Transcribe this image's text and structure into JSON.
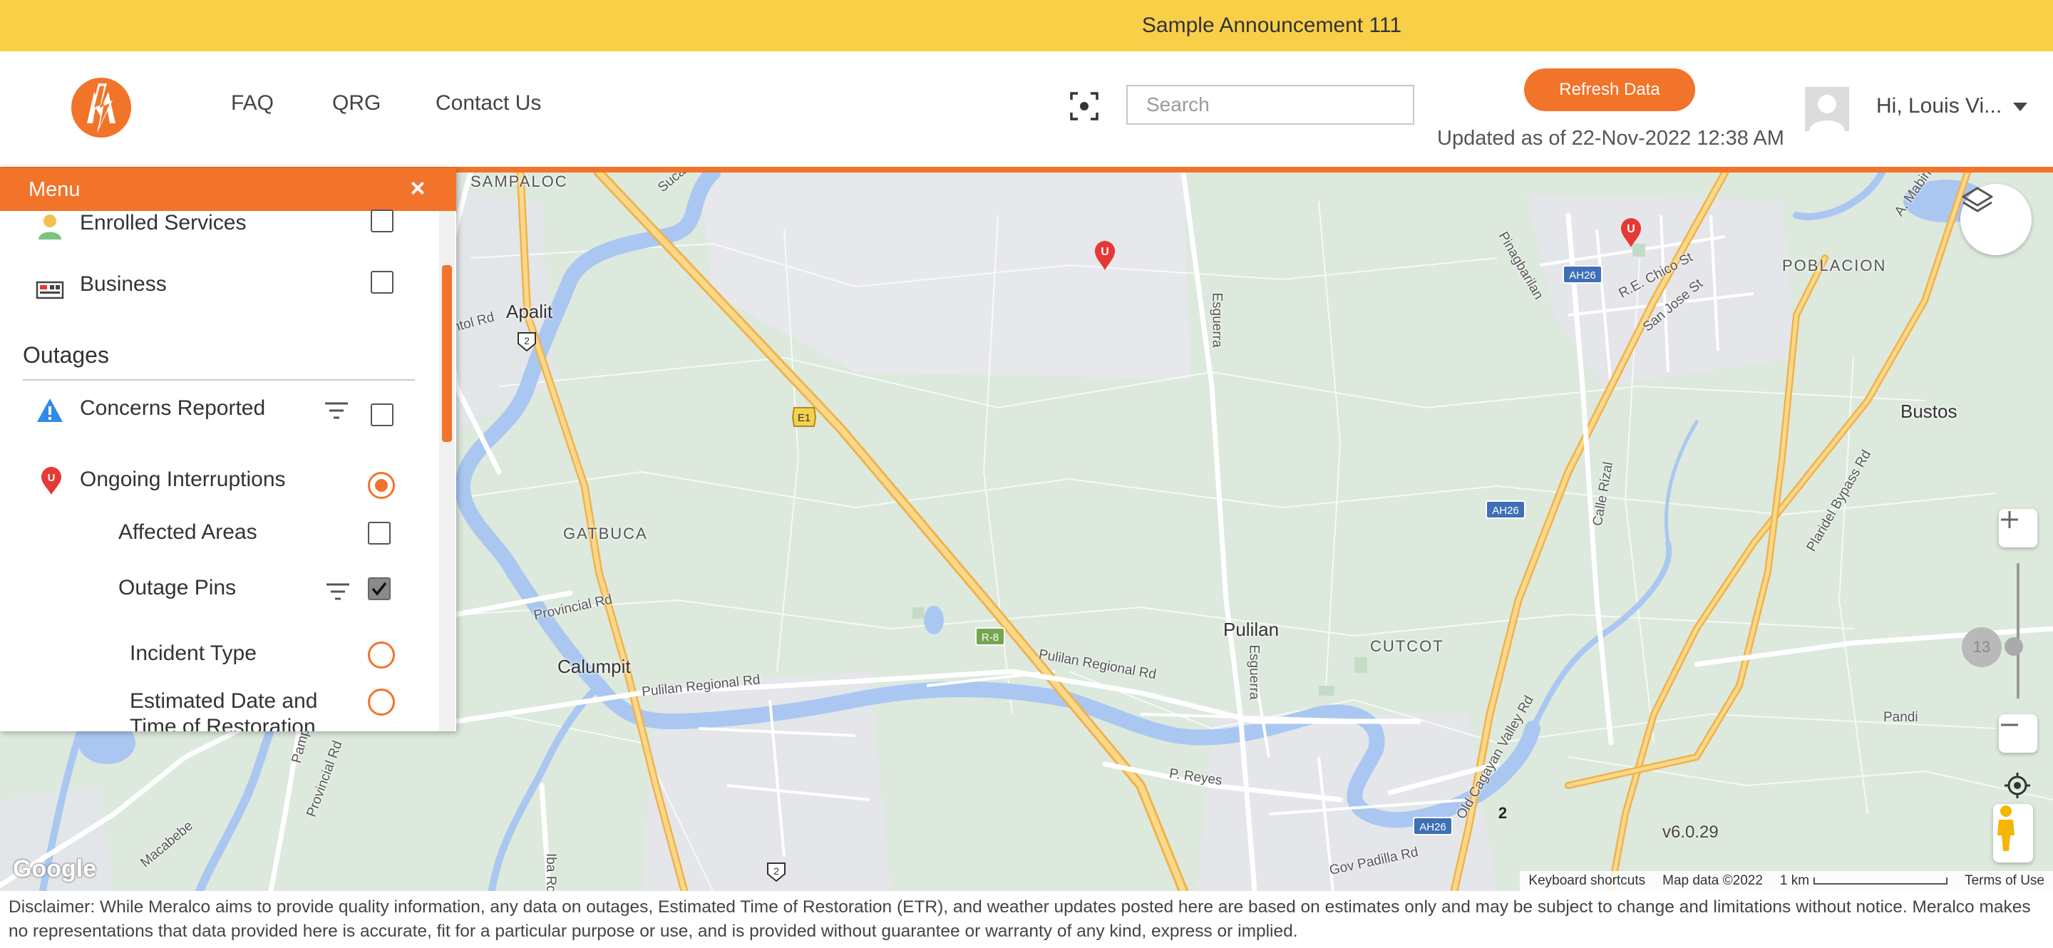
{
  "announcement": {
    "text": "Sample Announcement 111"
  },
  "header": {
    "logo_icon": "meralco-logo-icon",
    "nav": [
      {
        "label": "FAQ"
      },
      {
        "label": "QRG"
      },
      {
        "label": "Contact Us"
      }
    ],
    "scan_icon": "focus-scan-icon",
    "search": {
      "placeholder": "Search",
      "value": ""
    },
    "refresh_label": "Refresh Data",
    "updated_text": "Updated as of 22-Nov-2022 12:38 AM",
    "user_greeting": "Hi, Louis Vi...",
    "accent_color": "#f2732a"
  },
  "menu": {
    "title": "Menu",
    "close_glyph": "×",
    "items": [
      {
        "label": "Enrolled Services",
        "icon": "person-icon",
        "control": "checkbox",
        "checked": false
      },
      {
        "label": "Business",
        "icon": "business-icon",
        "control": "checkbox",
        "checked": false
      }
    ],
    "outages": {
      "title": "Outages",
      "items": [
        {
          "label": "Concerns Reported",
          "icon": "warning-icon",
          "control": "checkbox",
          "checked": false,
          "filter": true
        },
        {
          "label": "Ongoing Interruptions",
          "icon": "map-pin-u-icon",
          "control": "radio",
          "selected": true
        },
        {
          "label": "Affected Areas",
          "control": "checkbox",
          "checked": false
        },
        {
          "label": "Outage Pins",
          "control": "checkbox",
          "checked": true,
          "filter": true
        },
        {
          "label": "Incident Type",
          "control": "radio",
          "selected": false
        },
        {
          "label": "Estimated Date and Time of Restoration",
          "control": "radio",
          "selected": false
        }
      ]
    }
  },
  "map": {
    "places": [
      "SAMPALOC",
      "Apalit",
      "GATBUCA",
      "Calumpit",
      "Pulilan",
      "CUTCOT",
      "Bustos",
      "POBLACION"
    ],
    "roads": [
      "Provincial Rd",
      "Pulilan Regional Rd",
      "Pulilan Regional Rd",
      "Esguerra",
      "Esguerra",
      "Calle Rizal",
      "Plaridel Bypass Rd",
      "Old Cagayan Valley Rd",
      "Gov Padilla Rd",
      "P. Reyes",
      "Pinagbarilan",
      "R.E. Chico St",
      "San Jose St",
      "Pandi",
      "Macabebe",
      "Provincial Rd",
      "Pampang",
      "Sucad",
      "A. Mabini",
      "ntol Rd",
      "Iba Rd"
    ],
    "shields": [
      "E1",
      "R-8",
      "AH26",
      "AH26",
      "AH26",
      "2",
      "2"
    ],
    "cluster_count": "2",
    "zoom_level": "13",
    "version": "v6.0.29",
    "google": "Google",
    "attribution": {
      "shortcuts": "Keyboard shortcuts",
      "map_data": "Map data ©2022",
      "scale": "1 km",
      "terms": "Terms of Use"
    }
  },
  "disclaimer": "Disclaimer: While Meralco aims to provide quality information, any data on outages, Estimated Time of Restoration (ETR), and weather updates posted here are based on estimates only and may be subject to change and limitations without notice. Meralco makes no representations that data provided here is accurate, fit for a particular purpose or use, and is provided without guarantee or warranty of any kind, express or implied."
}
